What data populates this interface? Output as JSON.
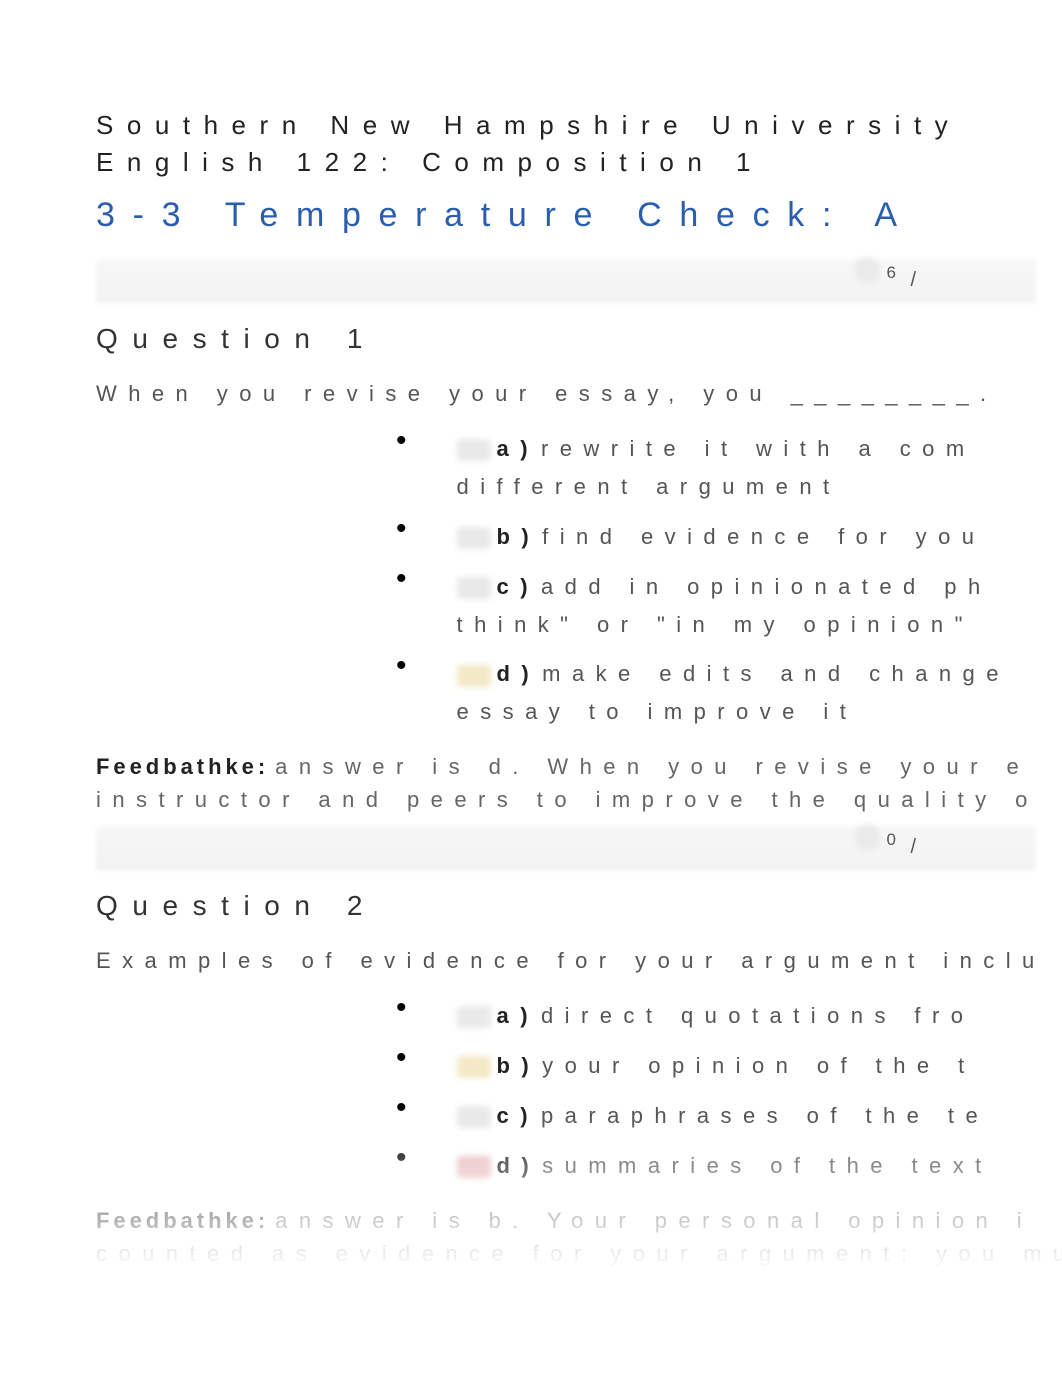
{
  "header": {
    "line1": "Southern New Hampshire University",
    "line2": "English 122: Composition 1"
  },
  "title": "3-3 Temperature Check: A",
  "questions": [
    {
      "score": "6",
      "slash": "/",
      "heading": "Question 1",
      "prompt": "When you revise your essay, you ________.",
      "options": [
        {
          "letter": "a)",
          "line1": "rewrite it with a com",
          "line2": "different argument",
          "marker": "mk-grey"
        },
        {
          "letter": "b)",
          "line1": "find evidence for you",
          "line2": "",
          "marker": "mk-grey"
        },
        {
          "letter": "c)",
          "line1": "add in opinionated ph",
          "line2": "think\" or \"in my opinion\"",
          "marker": "mk-grey"
        },
        {
          "letter": "d)",
          "line1": "make edits and change",
          "line2": "essay to improve it",
          "marker": "mk-yel"
        }
      ],
      "feedback_label": "Feedbathke:",
      "feedback": "answer is d. When you revise your e\ninstructor and peers to improve the quality o"
    },
    {
      "score": "0",
      "slash": "/",
      "heading": "Question 2",
      "prompt": "Examples of evidence for your argument inclu",
      "options": [
        {
          "letter": "a)",
          "line1": "direct quotations fro",
          "line2": "",
          "marker": "mk-grey"
        },
        {
          "letter": "b)",
          "line1": "your opinion of the t",
          "line2": "",
          "marker": "mk-yel"
        },
        {
          "letter": "c)",
          "line1": "paraphrases of the te",
          "line2": "",
          "marker": "mk-grey"
        },
        {
          "letter": "d)",
          "line1": "summaries of the text",
          "line2": "",
          "marker": "mk-red"
        }
      ],
      "feedback_label": "Feedbathke:",
      "feedback": "answer is b. Your personal opinion i\ncounted as evidence for your argument; you mu\nclaim."
    }
  ]
}
